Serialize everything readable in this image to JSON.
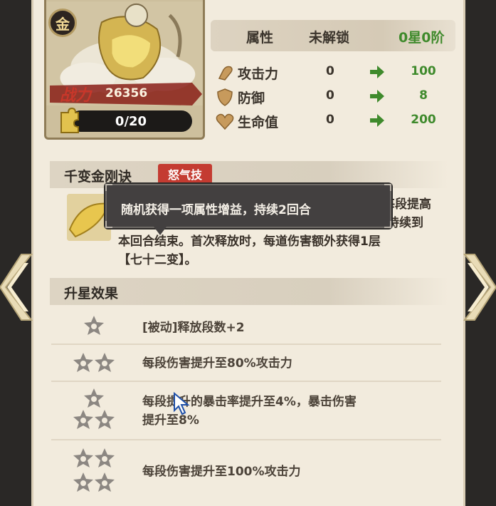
{
  "hero": {
    "grade_badge": "金",
    "power_label": "战力",
    "power_value": "26356",
    "fragment_progress": "0/20"
  },
  "stats": {
    "headers": {
      "attribute": "属性",
      "locked": "未解锁",
      "star_level": "0星0阶"
    },
    "rows": [
      {
        "icon": "attack-fist-icon",
        "name": "攻击力",
        "current": "0",
        "next": "100"
      },
      {
        "icon": "shield-icon",
        "name": "防御",
        "current": "0",
        "next": "8"
      },
      {
        "icon": "heart-icon",
        "name": "生命值",
        "current": "0",
        "next": "200"
      }
    ]
  },
  "skill": {
    "name": "千变金刚诀",
    "tag": "怒气技",
    "desc_line1_right": "每段提高",
    "desc_line2_right": "持续到",
    "desc_line3": "本回合结束。首次释放时，每道伤害额外获得1层",
    "desc_line4": "【七十二变】。"
  },
  "tooltip": {
    "text": "随机获得一项属性增益，持续2回合"
  },
  "star_upgrade": {
    "title": "升星效果",
    "rows": [
      {
        "stars": 1,
        "text": "[被动]释放段数+2"
      },
      {
        "stars": 2,
        "text": "每段伤害提升至80%攻击力"
      },
      {
        "stars": 3,
        "text_line1": "每段提升的暴击率提升至4%，暴击伤害",
        "text_line2": "提升至8%"
      },
      {
        "stars": 4,
        "text": "每段伤害提升至100%攻击力"
      }
    ]
  },
  "colors": {
    "panel_bg": "#f2ebdd",
    "accent_green": "#3f8a2c",
    "rage_tag": "#c43b31",
    "star_gray": "#8c8782"
  }
}
